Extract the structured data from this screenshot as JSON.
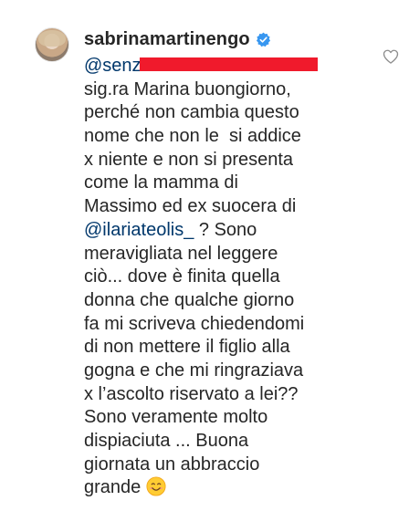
{
  "comment": {
    "username": "sabrinamartinengo",
    "mention_prefix": "@senz",
    "lines": [
      "sig.ra Marina buongiorno,",
      "perché non cambia questo",
      "nome che non le  si addice",
      "x niente e non si presenta",
      "come la mamma di",
      "Massimo ed ex suocera di"
    ],
    "mention_2": "@ilariateolis_",
    "after_mention_2": " ? Sono",
    "lines_after": [
      "meravigliata nel leggere",
      "ciò... dove è finita quella",
      "donna che qualche giorno",
      "fa mi scriveva chiedendomi",
      "di non mettere il figlio alla",
      "gogna e che mi ringraziava",
      "x l’ascolto riservato a lei??",
      "Sono veramente molto",
      "dispiaciuta ... Buona",
      "giornata un abbraccio"
    ],
    "last_line": "grande"
  },
  "icons": {
    "verified": "verified-badge-icon",
    "like": "heart-outline-icon",
    "emoji": "smiling-face-emoji"
  },
  "colors": {
    "text": "#262626",
    "mention": "#00376b",
    "verified": "#3897f0",
    "redaction": "#f01a2c"
  }
}
